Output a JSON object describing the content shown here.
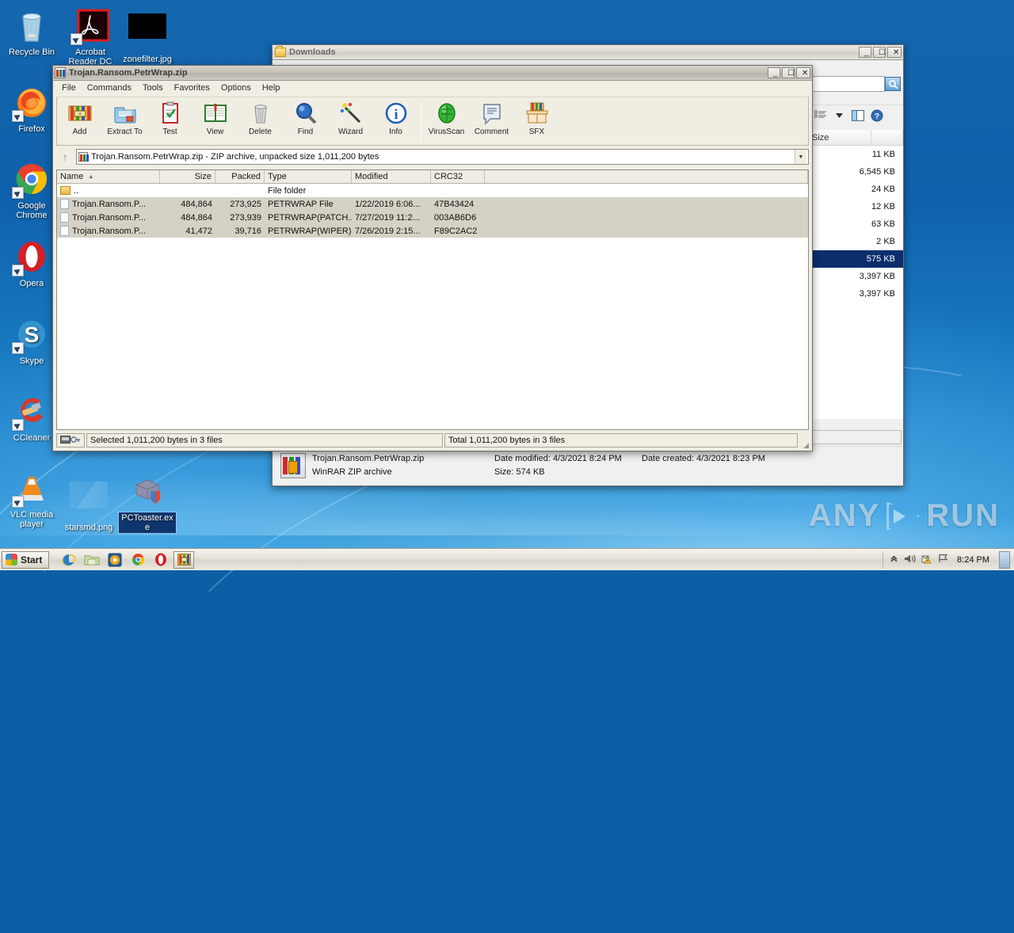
{
  "desktop": {
    "icons": [
      {
        "name": "Recycle Bin",
        "icon": "recycle-bin-icon",
        "shortcut": false,
        "selected": false
      },
      {
        "name": "Acrobat Reader DC",
        "icon": "acrobat-reader-icon",
        "shortcut": true,
        "selected": false
      },
      {
        "name": "zonefilter.jpg",
        "icon": "image-thumbnail-icon",
        "shortcut": false,
        "selected": false
      },
      {
        "name": "Firefox",
        "icon": "firefox-icon",
        "shortcut": true,
        "selected": false
      },
      {
        "name": "Google Chrome",
        "icon": "chrome-icon",
        "shortcut": true,
        "selected": false
      },
      {
        "name": "Opera",
        "icon": "opera-icon",
        "shortcut": true,
        "selected": false
      },
      {
        "name": "Skype",
        "icon": "skype-icon",
        "shortcut": true,
        "selected": false
      },
      {
        "name": "CCleaner",
        "icon": "ccleaner-icon",
        "shortcut": true,
        "selected": false
      },
      {
        "name": "VLC media player",
        "icon": "vlc-icon",
        "shortcut": true,
        "selected": false
      },
      {
        "name": "starsmd.png",
        "icon": "image-thumbnail-icon",
        "shortcut": false,
        "selected": false
      },
      {
        "name": "PCToaster.exe",
        "icon": "executable-shield-icon",
        "shortcut": false,
        "selected": true
      }
    ]
  },
  "winrar": {
    "title": "Trojan.Ransom.PetrWrap.zip",
    "window_buttons": {
      "minimize": "_",
      "maximize": "☐",
      "close": "✕"
    },
    "menu": [
      "File",
      "Commands",
      "Tools",
      "Favorites",
      "Options",
      "Help"
    ],
    "toolbar": [
      {
        "label": "Add",
        "icon": "add-archive-icon"
      },
      {
        "label": "Extract To",
        "icon": "extract-to-icon"
      },
      {
        "label": "Test",
        "icon": "test-archive-icon"
      },
      {
        "label": "View",
        "icon": "view-file-icon"
      },
      {
        "label": "Delete",
        "icon": "delete-icon"
      },
      {
        "label": "Find",
        "icon": "find-magnifier-icon"
      },
      {
        "label": "Wizard",
        "icon": "wizard-wand-icon"
      },
      {
        "label": "Info",
        "icon": "info-icon"
      },
      {
        "label": "VirusScan",
        "icon": "virusscan-icon"
      },
      {
        "label": "Comment",
        "icon": "comment-icon"
      },
      {
        "label": "SFX",
        "icon": "sfx-box-icon"
      }
    ],
    "address": {
      "up_label": "↑",
      "text": "Trojan.Ransom.PetrWrap.zip - ZIP archive, unpacked size 1,011,200 bytes",
      "dropdown": "▼"
    },
    "columns": [
      "Name",
      "Size",
      "Packed",
      "Type",
      "Modified",
      "CRC32"
    ],
    "sort_indicator": "▲",
    "rows": [
      {
        "name": "..",
        "size": "",
        "packed": "",
        "type": "File folder",
        "modified": "",
        "crc": "",
        "icon": "folder-up-icon",
        "selected": false
      },
      {
        "name": "Trojan.Ransom.P...",
        "size": "484,864",
        "packed": "273,925",
        "type": "PETRWRAP File",
        "modified": "1/22/2019 6:06...",
        "crc": "47B43424",
        "icon": "file-icon",
        "selected": true
      },
      {
        "name": "Trojan.Ransom.P...",
        "size": "484,864",
        "packed": "273,939",
        "type": "PETRWRAP(PATCH...",
        "modified": "7/27/2019 11:2...",
        "crc": "003AB6D6",
        "icon": "file-icon",
        "selected": true
      },
      {
        "name": "Trojan.Ransom.P...",
        "size": "41,472",
        "packed": "39,716",
        "type": "PETRWRAP(WIPER)...",
        "modified": "7/26/2019 2:15...",
        "crc": "F89C2AC2",
        "icon": "file-icon",
        "selected": true
      }
    ],
    "status": {
      "selected": "Selected 1,011,200 bytes in 3 files",
      "total": "Total 1,011,200 bytes in 3 files"
    }
  },
  "explorer": {
    "title": "Downloads",
    "window_buttons": {
      "minimize": "_",
      "maximize": "☐",
      "close": "✕"
    },
    "search_placeholder": "",
    "search_value": "",
    "toolbar_icons": [
      "views-list-icon",
      "chevron-down-icon",
      "preview-pane-icon",
      "help-icon"
    ],
    "columns": [
      "Size",
      ""
    ],
    "rows": [
      {
        "size": "11 KB",
        "selected": false
      },
      {
        "size": "6,545 KB",
        "selected": false
      },
      {
        "size": "24 KB",
        "selected": false
      },
      {
        "size": "12 KB",
        "selected": false
      },
      {
        "size": "63 KB",
        "selected": false
      },
      {
        "size": "2 KB",
        "selected": false
      },
      {
        "size": "575 KB",
        "selected": true
      },
      {
        "size": "3,397 KB",
        "selected": false
      },
      {
        "size": "3,397 KB",
        "selected": false
      }
    ],
    "inner_status_total": "Total 1,011,200 bytes in 3 files",
    "details": {
      "file_name": "Trojan.Ransom.PetrWrap.zip",
      "date_modified_label": "Date modified:",
      "date_modified_value": "4/3/2021 8:24 PM",
      "date_created_label": "Date created:",
      "date_created_value": "4/3/2021 8:23 PM",
      "file_type": "WinRAR ZIP archive",
      "size_label": "Size:",
      "size_value": "574 KB",
      "icon": "winrar-archive-icon"
    }
  },
  "watermark": {
    "left": "ANY",
    "right": "RUN",
    "icon": "play-triangle-icon"
  },
  "taskbar": {
    "start_label": "Start",
    "quick_launch": [
      {
        "name": "internet-explorer-icon",
        "active": false
      },
      {
        "name": "windows-explorer-icon",
        "active": false
      },
      {
        "name": "media-player-icon",
        "active": false
      },
      {
        "name": "chrome-icon",
        "active": false
      },
      {
        "name": "opera-icon",
        "active": false
      },
      {
        "name": "winrar-icon",
        "active": true
      }
    ],
    "tray": [
      "show-hidden-icons-arrow",
      "volume-icon",
      "action-center-icon",
      "network-icon"
    ],
    "clock": "8:24 PM"
  }
}
